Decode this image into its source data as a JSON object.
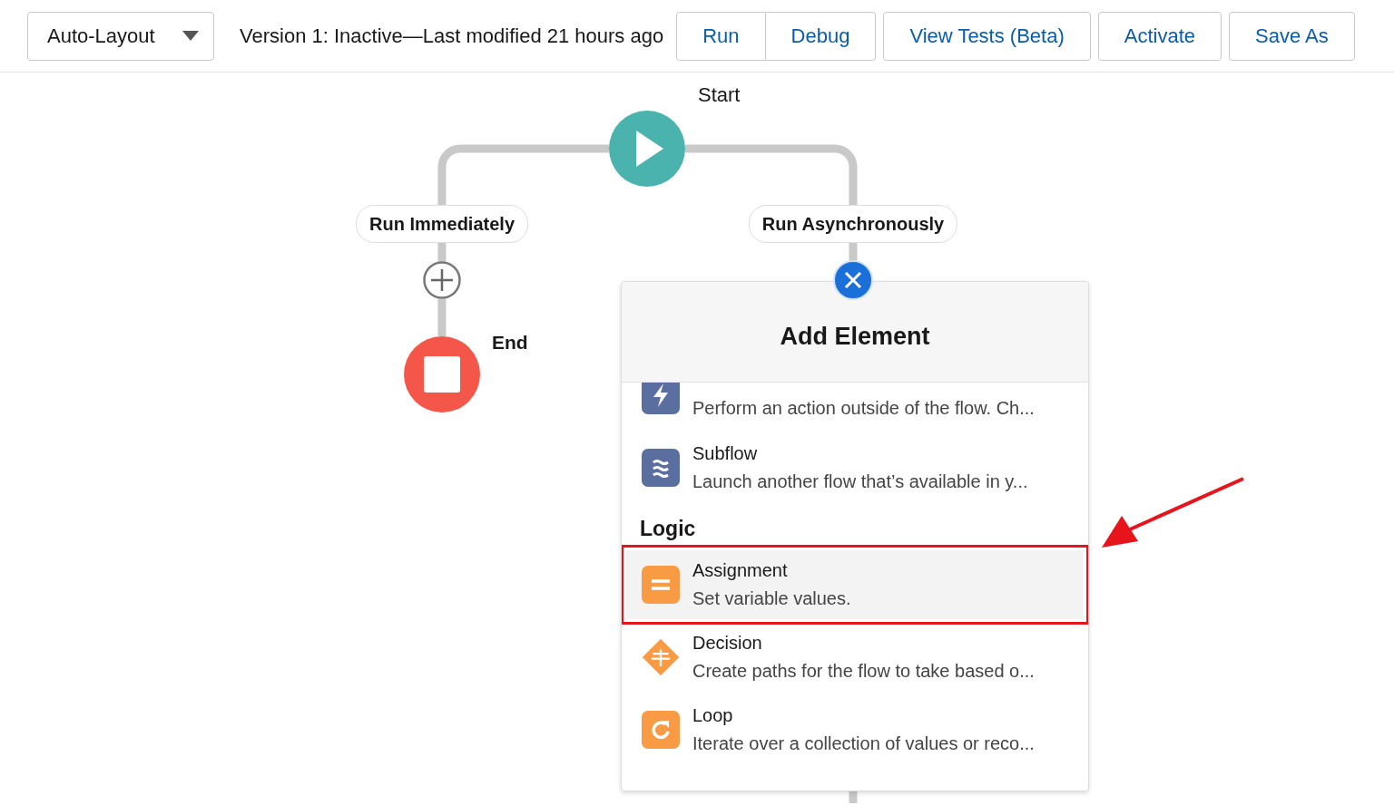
{
  "toolbar": {
    "layout_menu": "Auto-Layout",
    "version_text": "Version 1: Inactive—Last modified 21 hours ago",
    "button_groups": [
      [
        {
          "label": "Run"
        },
        {
          "label": "Debug"
        }
      ],
      [
        {
          "label": "View Tests (Beta)"
        }
      ],
      [
        {
          "label": "Activate"
        }
      ],
      [
        {
          "label": "Save As"
        }
      ]
    ]
  },
  "canvas": {
    "start_label": "Start",
    "branches": [
      {
        "label": "Run Immediately",
        "end_label": "End"
      },
      {
        "label": "Run Asynchronously"
      }
    ]
  },
  "add_element": {
    "title": "Add Element",
    "sections": [
      {
        "items": [
          {
            "kind": "action",
            "description": "Perform an action outside of the flow. Ch...",
            "selected": false,
            "annotated": false
          },
          {
            "kind": "subflow",
            "title": "Subflow",
            "description": "Launch another flow that’s available in y...",
            "selected": false,
            "annotated": false
          }
        ]
      },
      {
        "heading": "Logic",
        "items": [
          {
            "kind": "assignment",
            "title": "Assignment",
            "description": "Set variable values.",
            "selected": true,
            "annotated": true
          },
          {
            "kind": "decision",
            "title": "Decision",
            "description": "Create paths for the flow to take based o...",
            "selected": false,
            "annotated": false
          },
          {
            "kind": "loop",
            "title": "Loop",
            "description": "Iterate over a collection of values or reco...",
            "selected": false,
            "annotated": false
          }
        ]
      }
    ]
  }
}
